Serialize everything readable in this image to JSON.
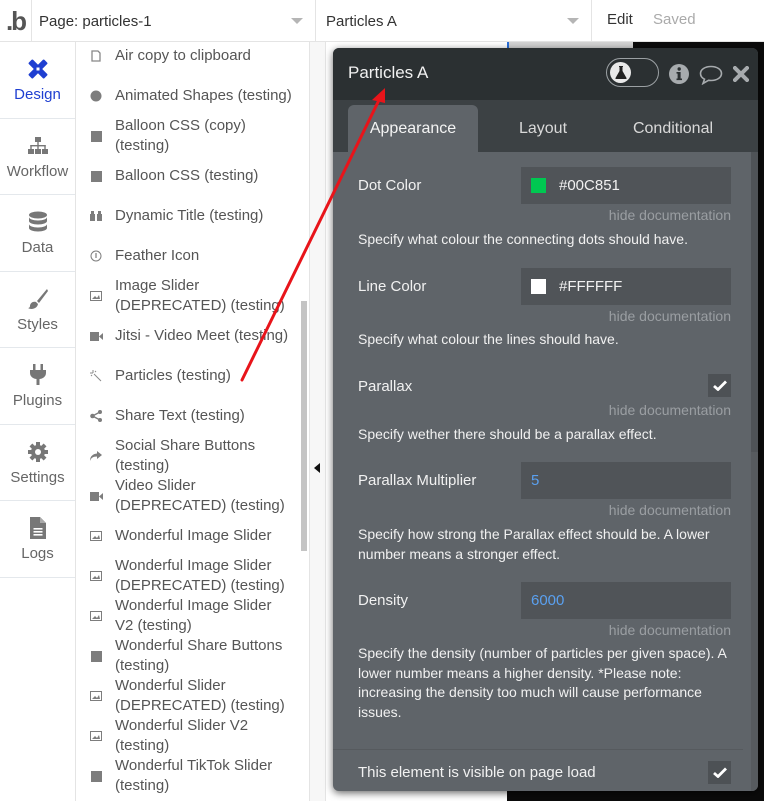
{
  "topbar": {
    "logo": ".b",
    "page_selector": "Page: particles-1",
    "element_selector": "Particles A",
    "edit_label": "Edit",
    "saved_status": "Saved"
  },
  "leftnav": {
    "items": [
      {
        "label": "Design",
        "icon": "pencil-ruler-icon",
        "active": true
      },
      {
        "label": "Workflow",
        "icon": "sitemap-icon"
      },
      {
        "label": "Data",
        "icon": "database-icon"
      },
      {
        "label": "Styles",
        "icon": "paintbrush-icon"
      },
      {
        "label": "Plugins",
        "icon": "plug-icon"
      },
      {
        "label": "Settings",
        "icon": "gear-icon"
      },
      {
        "label": "Logs",
        "icon": "file-icon"
      }
    ]
  },
  "elements_list": {
    "items": [
      {
        "label": "Air copy to clipboard",
        "icon": "clipboard-icon"
      },
      {
        "label": "Animated Shapes (testing)",
        "icon": "circle-icon"
      },
      {
        "label": "Balloon CSS (copy) (testing)",
        "icon": "square-icon"
      },
      {
        "label": "Balloon CSS (testing)",
        "icon": "square-icon"
      },
      {
        "label": "Dynamic Title (testing)",
        "icon": "quote-icon"
      },
      {
        "label": "Feather Icon",
        "icon": "info-circle-icon"
      },
      {
        "label": "Image Slider (DEPRECATED) (testing)",
        "icon": "image-icon"
      },
      {
        "label": "Jitsi - Video Meet (testing)",
        "icon": "video-icon"
      },
      {
        "label": "Particles (testing)",
        "icon": "magic-wand-icon"
      },
      {
        "label": "Share Text (testing)",
        "icon": "share-icon"
      },
      {
        "label": "Social Share Buttons (testing)",
        "icon": "share-arrow-icon"
      },
      {
        "label": "Video Slider (DEPRECATED) (testing)",
        "icon": "video-icon"
      },
      {
        "label": "Wonderful Image Slider",
        "icon": "image-icon"
      },
      {
        "label": "Wonderful Image Slider (DEPRECATED) (testing)",
        "icon": "image-icon"
      },
      {
        "label": "Wonderful Image Slider V2 (testing)",
        "icon": "image-icon"
      },
      {
        "label": "Wonderful Share Buttons (testing)",
        "icon": "square-icon"
      },
      {
        "label": "Wonderful Slider (DEPRECATED) (testing)",
        "icon": "image-icon"
      },
      {
        "label": "Wonderful Slider V2 (testing)",
        "icon": "image-icon"
      },
      {
        "label": "Wonderful TikTok Slider (testing)",
        "icon": "square-icon"
      }
    ]
  },
  "panel": {
    "title": "Particles A",
    "tabs": [
      {
        "label": "Appearance",
        "active": true
      },
      {
        "label": "Layout"
      },
      {
        "label": "Conditional"
      }
    ],
    "hide_doc_label": "hide documentation",
    "properties": {
      "dot_color": {
        "label": "Dot Color",
        "value": "#00C851",
        "swatch": "#00C851",
        "doc": "Specify what colour the connecting dots should have."
      },
      "line_color": {
        "label": "Line Color",
        "value": "#FFFFFF",
        "swatch": "#FFFFFF",
        "doc": "Specify what colour the lines should have."
      },
      "parallax": {
        "label": "Parallax",
        "checked": true,
        "doc": "Specify wether there should be a parallax effect."
      },
      "parallax_multiplier": {
        "label": "Parallax Multiplier",
        "value": "5",
        "doc": "Specify how strong the Parallax effect should be. A lower number means a stronger effect."
      },
      "density": {
        "label": "Density",
        "value": "6000",
        "doc": "Specify the density (number of particles per given space). A lower number means a higher density. *Please note: increasing the density too much will cause performance issues."
      }
    },
    "visible_on_load": {
      "label": "This element is visible on page load",
      "checked": true
    }
  },
  "colors": {
    "accent": "#1f3fd1",
    "panel_bg": "#5f6469",
    "panel_header": "#2b3032",
    "annotation_arrow": "#e8141a",
    "number_value": "#5aa0ef"
  }
}
